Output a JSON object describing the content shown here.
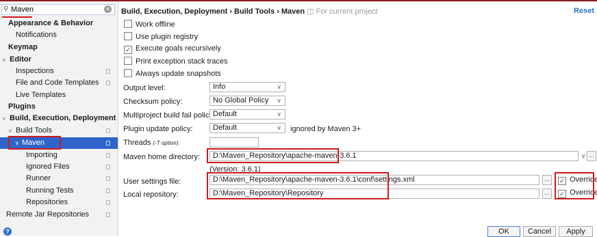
{
  "search": {
    "value": "Maven",
    "clear_icon": "clear-icon"
  },
  "sidebar": {
    "items": [
      {
        "label": "Appearance & Behavior",
        "bold": true
      },
      {
        "label": "Notifications"
      },
      {
        "label": "Keymap",
        "bold": true
      },
      {
        "label": "Editor",
        "bold": true,
        "arrow": "∨"
      },
      {
        "label": "Inspections"
      },
      {
        "label": "File and Code Templates"
      },
      {
        "label": "Live Templates"
      },
      {
        "label": "Plugins",
        "bold": true
      },
      {
        "label": "Build, Execution, Deployment",
        "bold": true,
        "arrow": "∨"
      },
      {
        "label": "Build Tools",
        "arrow": "∨"
      },
      {
        "label": "Maven",
        "arrow": "∨",
        "selected": true
      },
      {
        "label": "Importing"
      },
      {
        "label": "Ignored Files"
      },
      {
        "label": "Runner"
      },
      {
        "label": "Running Tests"
      },
      {
        "label": "Repositories"
      },
      {
        "label": "Remote Jar Repositories"
      }
    ]
  },
  "breadcrumb": {
    "path": "Build, Execution, Deployment › Build Tools › Maven",
    "note": "For current project"
  },
  "reset_label": "Reset",
  "checkboxes": [
    {
      "label": "Work offline",
      "checked": false
    },
    {
      "label": "Use plugin registry",
      "checked": false
    },
    {
      "label": "Execute goals recursively",
      "checked": true
    },
    {
      "label": "Print exception stack traces",
      "checked": false
    },
    {
      "label": "Always update snapshots",
      "checked": false
    }
  ],
  "fields": {
    "output_level": {
      "label": "Output level:",
      "value": "Info"
    },
    "checksum_policy": {
      "label": "Checksum policy:",
      "value": "No Global Policy"
    },
    "multiproject_fail_policy": {
      "label": "Multiproject build fail policy:",
      "value": "Default"
    },
    "plugin_update_policy": {
      "label": "Plugin update policy:",
      "value": "Default",
      "note": "ignored by Maven 3+"
    },
    "threads": {
      "label": "Threads",
      "hint": "(-T option):",
      "value": ""
    },
    "maven_home": {
      "label": "Maven home directory:",
      "value": "D:\\Maven_Repository\\apache-maven-3.6.1",
      "version": "(Version: 3.6.1)"
    },
    "user_settings": {
      "label": "User settings file:",
      "value": "D:\\Maven_Repository\\apache-maven-3.6.1\\conf\\settings.xml",
      "override": "Override",
      "override_checked": true
    },
    "local_repo": {
      "label": "Local repository:",
      "value": "D:\\Maven_Repository\\Repository",
      "override": "Override",
      "override_checked": true
    }
  },
  "browse_label": "...",
  "buttons": {
    "ok": "OK",
    "cancel": "Cancel",
    "apply": "Apply"
  },
  "help_icon": "?",
  "colors": {
    "selection": "#2f65ca",
    "highlight_box": "#d01919",
    "link": "#2e6fcf"
  }
}
